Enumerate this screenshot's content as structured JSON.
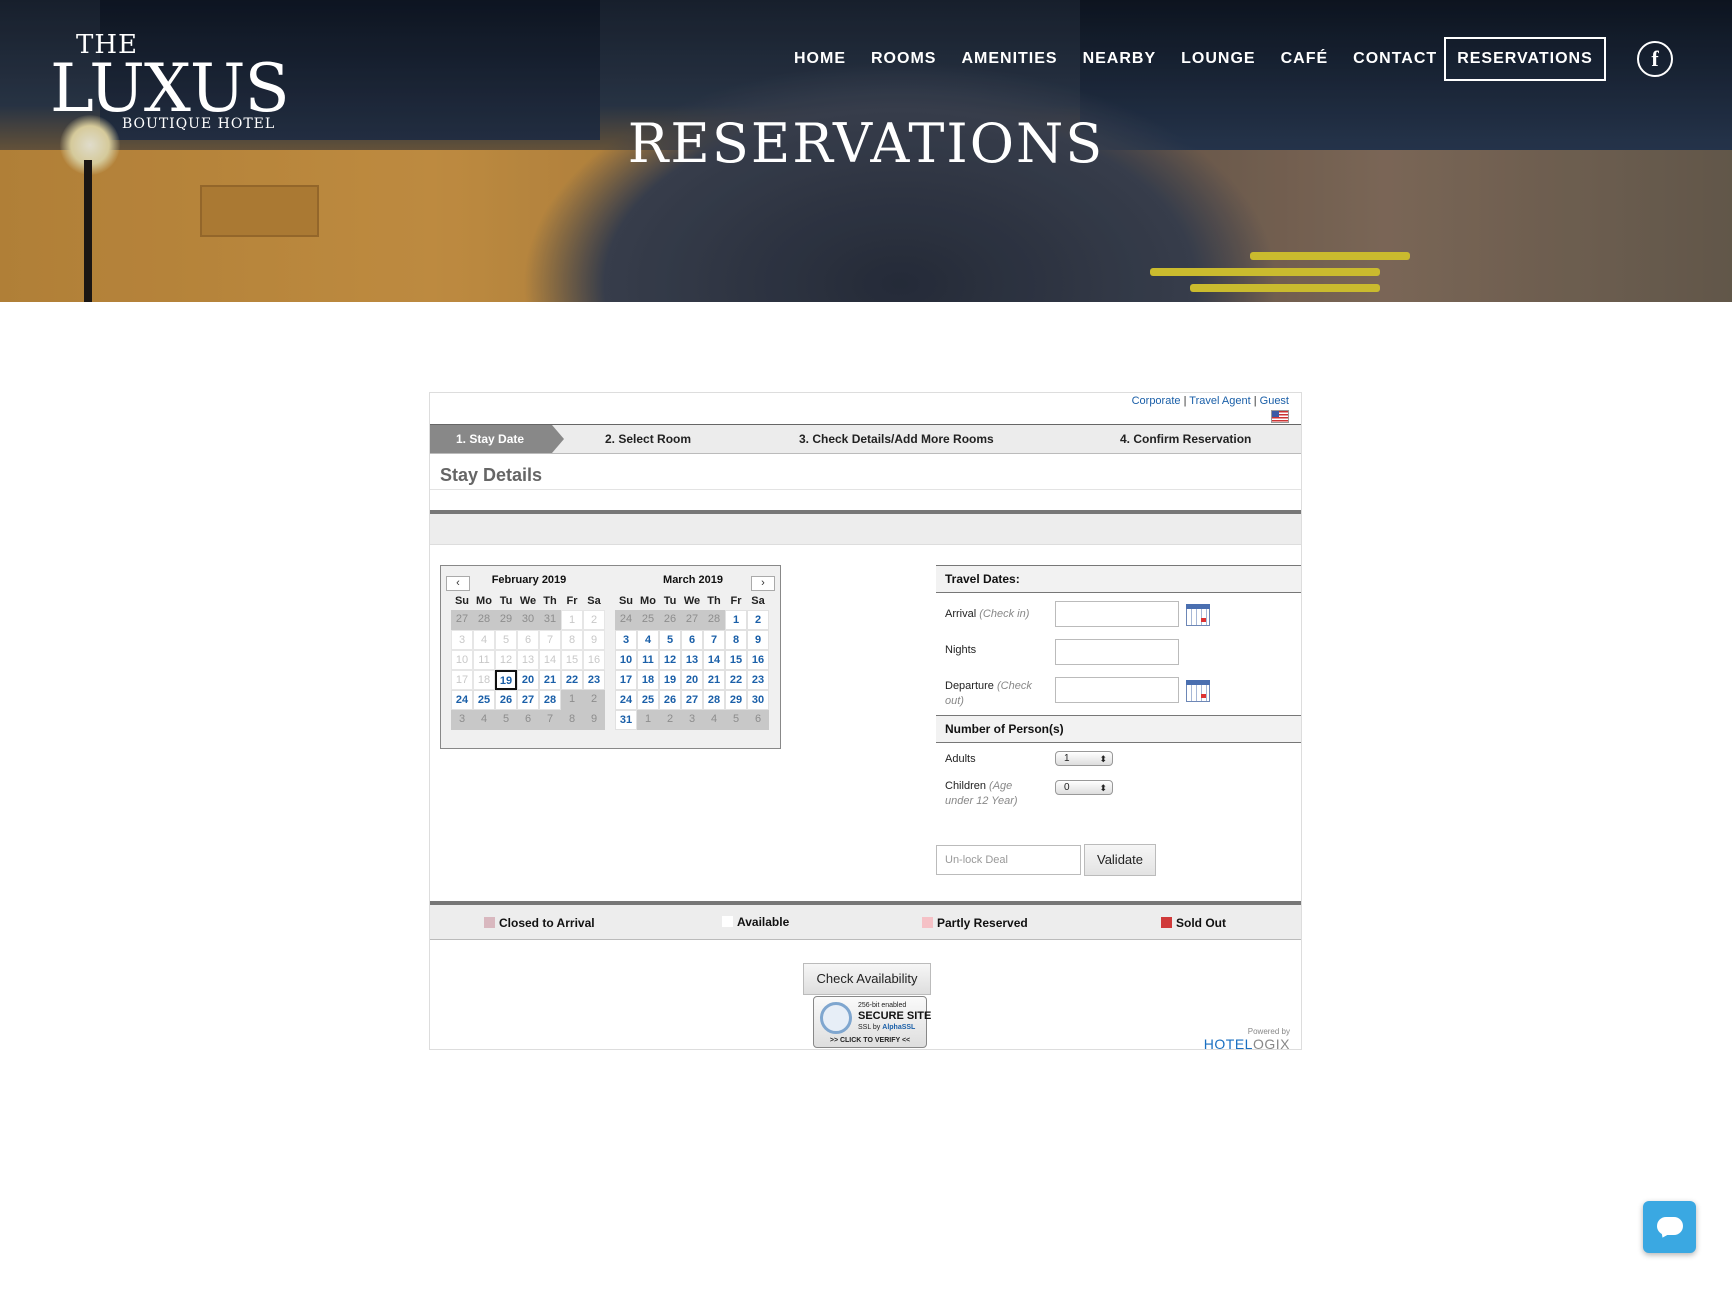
{
  "logo": {
    "the": "THE",
    "name": "LUXUS",
    "sub": "BOUTIQUE HOTEL"
  },
  "nav": [
    "HOME",
    "ROOMS",
    "AMENITIES",
    "NEARBY",
    "LOUNGE",
    "CAFÉ",
    "CONTACT"
  ],
  "nav_cta": "RESERVATIONS",
  "facebook_glyph": "f",
  "hero_title": "RESERVATIONS",
  "toplinks": {
    "corporate": "Corporate",
    "travel_agent": "Travel Agent",
    "guest": "Guest",
    "sep": "|"
  },
  "steps": [
    "1. Stay Date",
    "2. Select Room",
    "3. Check Details/Add More Rooms",
    "4. Confirm Reservation"
  ],
  "section_title": "Stay Details",
  "calendar": {
    "prev": "‹",
    "next": "›",
    "dow": [
      "Su",
      "Mo",
      "Tu",
      "We",
      "Th",
      "Fr",
      "Sa"
    ],
    "months": [
      {
        "title": "February 2019",
        "days": [
          [
            "27",
            "other"
          ],
          [
            "28",
            "other"
          ],
          [
            "29",
            "other"
          ],
          [
            "30",
            "other"
          ],
          [
            "31",
            "other"
          ],
          [
            "1",
            "past"
          ],
          [
            "2",
            "past"
          ],
          [
            "3",
            "past"
          ],
          [
            "4",
            "past"
          ],
          [
            "5",
            "past"
          ],
          [
            "6",
            "past"
          ],
          [
            "7",
            "past"
          ],
          [
            "8",
            "past"
          ],
          [
            "9",
            "past"
          ],
          [
            "10",
            "past"
          ],
          [
            "11",
            "past"
          ],
          [
            "12",
            "past"
          ],
          [
            "13",
            "past"
          ],
          [
            "14",
            "past"
          ],
          [
            "15",
            "past"
          ],
          [
            "16",
            "past"
          ],
          [
            "17",
            "past"
          ],
          [
            "18",
            "past"
          ],
          [
            "19",
            "today"
          ],
          [
            "20",
            "avail"
          ],
          [
            "21",
            "avail"
          ],
          [
            "22",
            "avail"
          ],
          [
            "23",
            "avail"
          ],
          [
            "24",
            "avail"
          ],
          [
            "25",
            "avail"
          ],
          [
            "26",
            "avail"
          ],
          [
            "27",
            "avail"
          ],
          [
            "28",
            "avail"
          ],
          [
            "1",
            "other"
          ],
          [
            "2",
            "other"
          ],
          [
            "3",
            "other"
          ],
          [
            "4",
            "other"
          ],
          [
            "5",
            "other"
          ],
          [
            "6",
            "other"
          ],
          [
            "7",
            "other"
          ],
          [
            "8",
            "other"
          ],
          [
            "9",
            "other"
          ]
        ]
      },
      {
        "title": "March 2019",
        "days": [
          [
            "24",
            "other"
          ],
          [
            "25",
            "other"
          ],
          [
            "26",
            "other"
          ],
          [
            "27",
            "other"
          ],
          [
            "28",
            "other"
          ],
          [
            "1",
            "avail"
          ],
          [
            "2",
            "avail"
          ],
          [
            "3",
            "avail"
          ],
          [
            "4",
            "avail"
          ],
          [
            "5",
            "avail"
          ],
          [
            "6",
            "avail"
          ],
          [
            "7",
            "avail"
          ],
          [
            "8",
            "avail"
          ],
          [
            "9",
            "avail"
          ],
          [
            "10",
            "avail"
          ],
          [
            "11",
            "avail"
          ],
          [
            "12",
            "avail"
          ],
          [
            "13",
            "avail"
          ],
          [
            "14",
            "avail"
          ],
          [
            "15",
            "avail"
          ],
          [
            "16",
            "avail"
          ],
          [
            "17",
            "avail"
          ],
          [
            "18",
            "avail"
          ],
          [
            "19",
            "avail"
          ],
          [
            "20",
            "avail"
          ],
          [
            "21",
            "avail"
          ],
          [
            "22",
            "avail"
          ],
          [
            "23",
            "avail"
          ],
          [
            "24",
            "avail"
          ],
          [
            "25",
            "avail"
          ],
          [
            "26",
            "avail"
          ],
          [
            "27",
            "avail"
          ],
          [
            "28",
            "avail"
          ],
          [
            "29",
            "avail"
          ],
          [
            "30",
            "avail"
          ],
          [
            "31",
            "avail"
          ],
          [
            "1",
            "other"
          ],
          [
            "2",
            "other"
          ],
          [
            "3",
            "other"
          ],
          [
            "4",
            "other"
          ],
          [
            "5",
            "other"
          ],
          [
            "6",
            "other"
          ]
        ]
      }
    ]
  },
  "travel": {
    "dates_heading": "Travel Dates:",
    "arrival_label": "Arrival",
    "arrival_hint": "(Check in)",
    "arrival_value": "",
    "nights_label": "Nights",
    "nights_value": "",
    "departure_label": "Departure",
    "departure_hint": "(Check out)",
    "departure_value": "",
    "persons_heading": "Number of Person(s)",
    "adults_label": "Adults",
    "adults_value": "1",
    "children_label": "Children",
    "children_hint": "(Age under 12 Year)",
    "children_value": "0"
  },
  "deal": {
    "placeholder": "Un-lock Deal",
    "button": "Validate"
  },
  "legend": [
    {
      "label": "Closed to Arrival",
      "color": "#d9b8bf"
    },
    {
      "label": "Available",
      "color": "#ffffff"
    },
    {
      "label": "Partly Reserved",
      "color": "#f5c1c6"
    },
    {
      "label": "Sold Out",
      "color": "#d03a3a"
    }
  ],
  "check_button": "Check Availability",
  "ssl": {
    "line1": "256-bit enabled",
    "line2": "SECURE SITE",
    "line3a": "SSL by ",
    "line3b": "AlphaSSL",
    "line4": ">> CLICK TO VERIFY <<"
  },
  "powered": {
    "label": "Powered by",
    "brand_a": "HOTEL",
    "brand_b": "OGIX"
  },
  "colors": {
    "link": "#1a5fa8",
    "chat": "#3aa8e2"
  }
}
